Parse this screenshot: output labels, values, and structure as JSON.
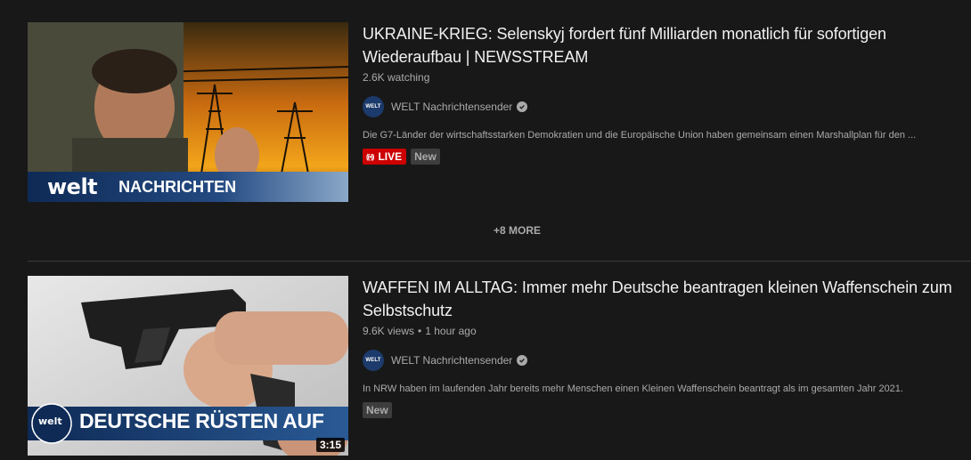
{
  "results": [
    {
      "title": "UKRAINE-KRIEG: Selenskyj fordert fünf Milliarden monatlich für sofortigen Wiederaufbau | NEWSSTREAM",
      "meta_views": "2.6K watching",
      "meta_time": "",
      "channel": "WELT Nachrichtensender",
      "channel_avatar_text": "WELT",
      "description": "Die G7-Länder der wirtschaftsstarken Demokratien und die Europäische Union haben gemeinsam einen Marshallplan für den ...",
      "live_label": "LIVE",
      "new_label": "New",
      "thumb_logo": "WELT",
      "thumb_caption": "NACHRICHTEN"
    },
    {
      "title": "WAFFEN IM ALLTAG: Immer mehr Deutsche beantragen kleinen Waffenschein zum Selbstschutz",
      "meta_views": "9.6K views",
      "meta_time": "1 hour ago",
      "channel": "WELT Nachrichtensender",
      "channel_avatar_text": "WELT",
      "description": "In NRW haben im laufenden Jahr bereits mehr Menschen einen Kleinen Waffenschein beantragt als im gesamten Jahr 2021.",
      "new_label": "New",
      "thumb_logo": "WELT",
      "thumb_caption": "DEUTSCHE RÜSTEN AUF",
      "duration": "3:15"
    }
  ],
  "more_label": "+8 MORE",
  "colors": {
    "background": "#181818",
    "live_red": "#cc0000",
    "welt_blue": "#1c3a6b"
  }
}
